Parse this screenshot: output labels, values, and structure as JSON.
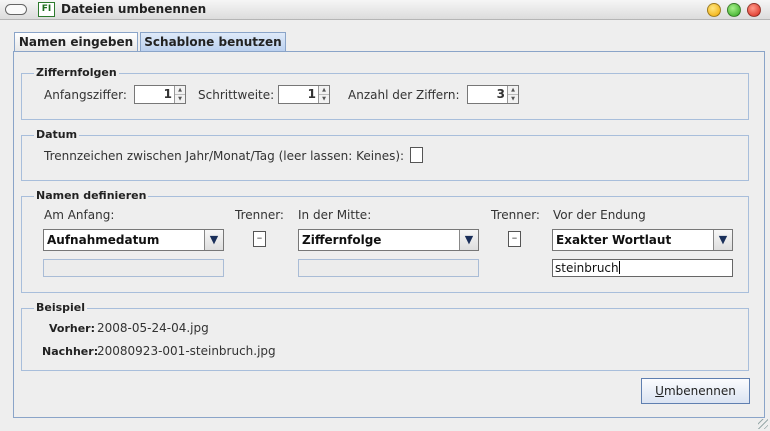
{
  "window": {
    "app_icon_text": "FI",
    "title": "Dateien umbenennen"
  },
  "tabs": [
    {
      "label": "Namen eingeben",
      "active": false
    },
    {
      "label": "Schablone benutzen",
      "active": true
    }
  ],
  "digits": {
    "title": "Ziffernfolgen",
    "start_label": "Anfangsziffer:",
    "start_value": "1",
    "step_label": "Schrittweite:",
    "step_value": "1",
    "count_label": "Anzahl der Ziffern:",
    "count_value": "3"
  },
  "date": {
    "title": "Datum",
    "separator_label": "Trennzeichen zwischen Jahr/Monat/Tag (leer lassen: Keines):",
    "separator_value": ""
  },
  "names": {
    "title": "Namen definieren",
    "start_label": "Am Anfang:",
    "start_value": "Aufnahmedatum",
    "sep1_label": "Trenner:",
    "sep1_value": "–",
    "middle_label": "In der Mitte:",
    "middle_value": "Ziffernfolge",
    "sep2_label": "Trenner:",
    "sep2_value": "–",
    "end_label": "Vor der Endung",
    "end_value": "Exakter Wortlaut",
    "end_text": "steinbruch"
  },
  "example": {
    "title": "Beispiel",
    "before_label": "Vorher:",
    "before_value": "2008-05-24-04.jpg",
    "after_label": "Nachher:",
    "after_value": "20080923-001-steinbruch.jpg"
  },
  "actions": {
    "rename_mnemonic": "U",
    "rename_rest": "mbenennen"
  },
  "icons": {
    "combo_arrow": "chevron-down-icon",
    "spinner_up": "spinner-up-icon",
    "spinner_down": "spinner-down-icon"
  }
}
